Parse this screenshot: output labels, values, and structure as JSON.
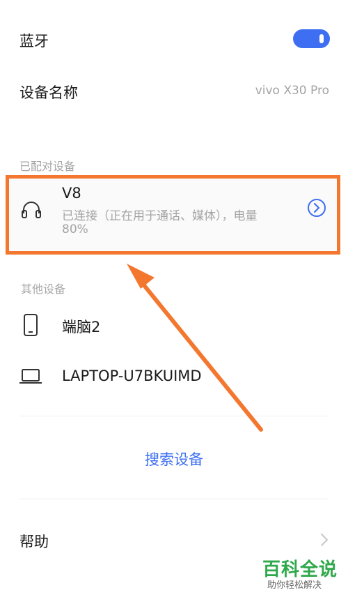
{
  "bluetooth": {
    "label": "蓝牙",
    "enabled": true
  },
  "device_name": {
    "label": "设备名称",
    "value": "vivo X30 Pro"
  },
  "paired_devices": {
    "section_label": "已配对设备",
    "items": [
      {
        "name": "V8",
        "status": "已连接（正在用于通话、媒体），电量",
        "status_line2": "80%",
        "icon": "headphones-icon"
      }
    ]
  },
  "other_devices": {
    "section_label": "其他设备",
    "items": [
      {
        "name": "端脑2",
        "icon": "phone-icon"
      },
      {
        "name": "LAPTOP-U7BKUIMD",
        "icon": "laptop-icon"
      }
    ]
  },
  "search_button": {
    "label": "搜索设备"
  },
  "help": {
    "label": "帮助"
  },
  "watermark": {
    "title": "百科全说",
    "subtitle": "助你轻松解决"
  },
  "colors": {
    "accent": "#3e6ff2",
    "highlight": "#f3772f",
    "watermark": "#2ea84a"
  }
}
